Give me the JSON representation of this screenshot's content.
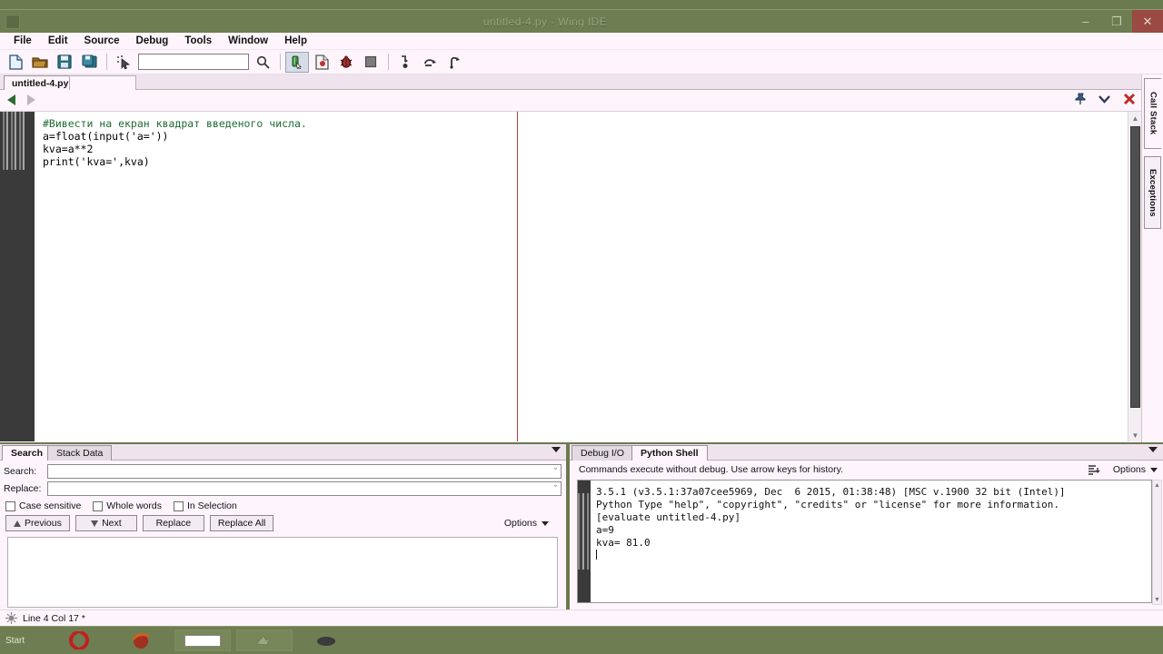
{
  "window": {
    "title": "untitled-4.py - Wing IDE",
    "app_icon": "wing-ide-icon",
    "minimize_label": "–",
    "maximize_label": "❐",
    "close_label": "✕"
  },
  "menubar": {
    "items": [
      "File",
      "Edit",
      "Source",
      "Debug",
      "Tools",
      "Window",
      "Help"
    ]
  },
  "toolbar": {
    "search_value": "",
    "buttons": [
      {
        "name": "new-file-icon",
        "label": "New File"
      },
      {
        "name": "open-folder-icon",
        "label": "Open"
      },
      {
        "name": "save-icon",
        "label": "Save"
      },
      {
        "name": "save-all-icon",
        "label": "Save All"
      },
      {
        "name": "select-pointer-icon",
        "label": "Select"
      },
      {
        "name": "search-icon",
        "label": "Search"
      },
      {
        "name": "run-icon",
        "label": "Run"
      },
      {
        "name": "debug-file-icon",
        "label": "Debug File"
      },
      {
        "name": "bug-icon",
        "label": "Toggle Breakpoint"
      },
      {
        "name": "stop-icon",
        "label": "Stop"
      },
      {
        "name": "step-into-icon",
        "label": "Step Into"
      },
      {
        "name": "step-over-icon",
        "label": "Step Over"
      },
      {
        "name": "step-out-icon",
        "label": "Step Out"
      }
    ]
  },
  "editor": {
    "tab_label": "untitled-4.py",
    "nav_back": "◀",
    "nav_forward": "▶",
    "pin_icon": "pin-icon",
    "menu_icon": "chevron-down-icon",
    "close_icon": "close-icon",
    "code_lines": [
      "#Вивести на екран квадрат введеного числа.",
      "a=float(input('a='))",
      "kva=a**2",
      "print('kva=',kva)"
    ],
    "code_text": "#Вивести на екран квадрат введеного числа.\na=float(input('a='))\nkva=a**2\nprint('kva=',kva)"
  },
  "right_dock": {
    "tabs": [
      {
        "label": "Call Stack",
        "active": true
      },
      {
        "label": "Exceptions",
        "active": false
      }
    ]
  },
  "search_panel": {
    "tabs": [
      {
        "label": "Search",
        "active": true
      },
      {
        "label": "Stack Data",
        "active": false
      }
    ],
    "search_label": "Search:",
    "search_value": "",
    "replace_label": "Replace:",
    "replace_value": "",
    "checkboxes": [
      {
        "label": "Case sensitive",
        "checked": false
      },
      {
        "label": "Whole words",
        "checked": false
      },
      {
        "label": "In Selection",
        "checked": false
      }
    ],
    "buttons": [
      "Previous",
      "Next",
      "Replace",
      "Replace All"
    ],
    "options_label": "Options",
    "dropdown_glyph": "ˇ"
  },
  "shell_panel": {
    "tabs": [
      {
        "label": "Debug I/O",
        "active": false
      },
      {
        "label": "Python Shell",
        "active": true
      }
    ],
    "hint": "Commands execute without debug.  Use arrow keys for history.",
    "wrap_icon": "wrap-lines-icon",
    "options_label": "Options",
    "output": "3.5.1 (v3.5.1:37a07cee5969, Dec  6 2015, 01:38:48) [MSC v.1900 32 bit (Intel)]\nPython Type \"help\", \"copyright\", \"credits\" or \"license\" for more information.\n[evaluate untitled-4.py]\na=9\nkva= 81.0\n",
    "output_lines": [
      "3.5.1 (v3.5.1:37a07cee5969, Dec  6 2015, 01:38:48) [MSC v.1900 32 bit (Intel)]",
      "Python Type \"help\", \"copyright\", \"credits\" or \"license\" for more information.",
      "[evaluate untitled-4.py]",
      "a=9",
      "kva= 81.0"
    ]
  },
  "statusbar": {
    "icon": "wing-bug-icon",
    "text": "Line 4 Col 17 *"
  },
  "taskbar": {
    "start_label": "Start",
    "items": [
      "opera-icon",
      "firefox-icon",
      "window-icon",
      "wing-ide-icon",
      "mouse-icon"
    ]
  },
  "colors": {
    "title_bar": "#6e7d52",
    "chrome": "#fdf5fb",
    "accent_close": "#9a4a42",
    "comment_green": "#1f6b33",
    "string_green": "#0a6b1f",
    "ruler_red": "#c23a3a",
    "gutter_dark": "#3a3a3a"
  }
}
